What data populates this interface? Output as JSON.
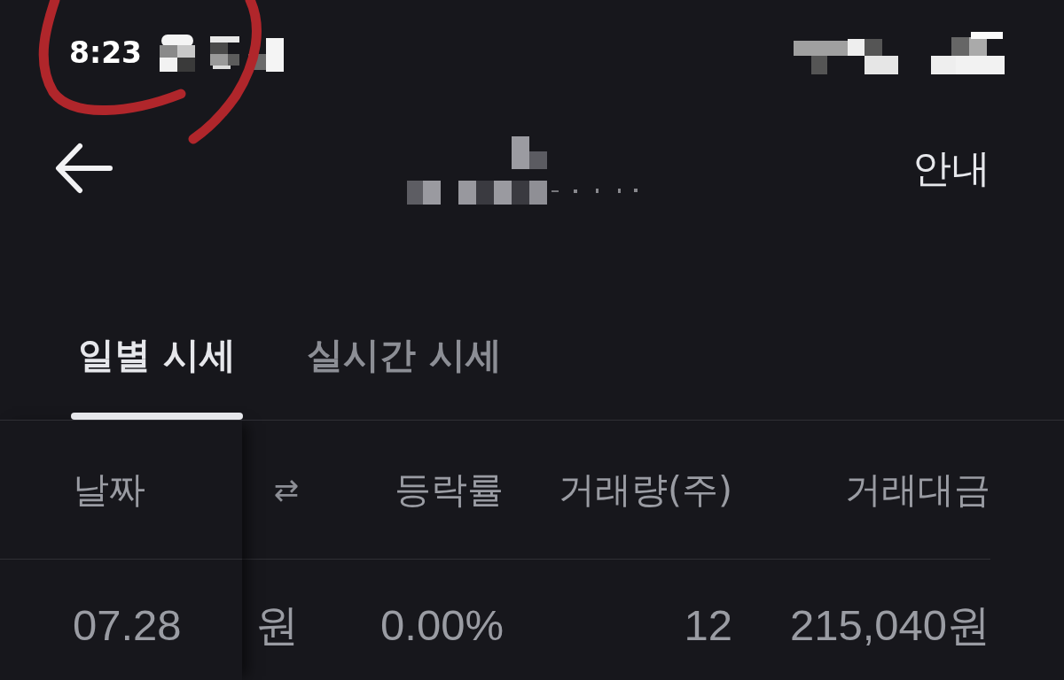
{
  "status_bar": {
    "time": "8:23",
    "circled": true,
    "icons_redacted": true
  },
  "top_bar": {
    "title_redacted": true,
    "action": "안내"
  },
  "tabs": [
    {
      "label": "일별 시세",
      "selected": true
    },
    {
      "label": "실시간 시세",
      "selected": false
    }
  ],
  "table": {
    "columns": [
      "날짜",
      "⇄",
      "등락률",
      "거래량(주)",
      "거래대금"
    ],
    "rows": [
      [
        "07.28",
        "원",
        "0.00%",
        "12",
        "215,040원"
      ]
    ]
  }
}
